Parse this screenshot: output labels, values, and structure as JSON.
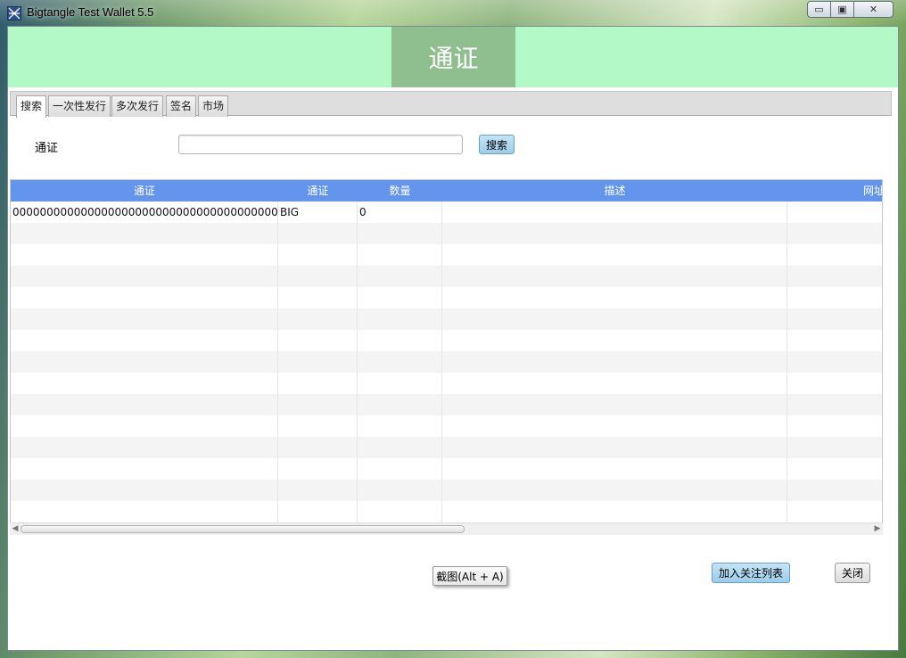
{
  "window": {
    "title": "Bigtangle Test Wallet 5.5",
    "buttons": {
      "minimize": "▭",
      "maximize": "▣",
      "close": "✕"
    }
  },
  "header": {
    "title": "通证"
  },
  "tabs": [
    {
      "label": "搜索",
      "active": true
    },
    {
      "label": "一次性发行",
      "active": false
    },
    {
      "label": "多次发行",
      "active": false
    },
    {
      "label": "签名",
      "active": false
    },
    {
      "label": "市场",
      "active": false
    }
  ],
  "search": {
    "label": "通证",
    "input_value": "",
    "button_label": "搜索"
  },
  "table": {
    "columns": [
      "通证",
      "通证",
      "数量",
      "描述",
      "网址"
    ],
    "rows": [
      [
        "000000000000000000000000000000000000000...",
        "BIG",
        "0",
        "",
        ""
      ]
    ]
  },
  "footer": {
    "screenshot_hint": "截图(Alt + A)",
    "add_watchlist_label": "加入关注列表",
    "close_label": "关闭"
  }
}
